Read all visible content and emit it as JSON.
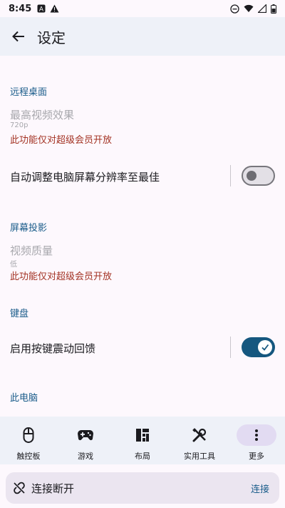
{
  "status_bar": {
    "time": "8:45"
  },
  "header": {
    "title": "设定"
  },
  "sections": {
    "remote_desktop": {
      "header": "远程桌面",
      "video_quality": {
        "title": "最高视频效果",
        "value": "720p",
        "notice": "此功能仅对超级会员开放"
      },
      "auto_resize": {
        "label": "自动调整电脑屏幕分辨率至最佳",
        "enabled": false
      }
    },
    "screen_cast": {
      "header": "屏幕投影",
      "video_quality": {
        "title": "视频质量",
        "value": "低",
        "notice": "此功能仅对超级会员开放"
      }
    },
    "keyboard": {
      "header": "键盘",
      "haptic": {
        "label": "启用按键震动回馈",
        "enabled": true
      }
    },
    "this_pc": {
      "header": "此电脑"
    }
  },
  "bottom_nav": {
    "items": [
      {
        "label": "触控板",
        "icon": "mouse-icon"
      },
      {
        "label": "游戏",
        "icon": "gamepad-icon"
      },
      {
        "label": "布局",
        "icon": "layout-icon"
      },
      {
        "label": "实用工具",
        "icon": "tools-icon"
      },
      {
        "label": "更多",
        "icon": "more-vert-icon",
        "active": true
      }
    ]
  },
  "connection": {
    "status": "连接断开",
    "action": "连接"
  },
  "colors": {
    "accent": "#15577f",
    "warning": "#a33223",
    "section": "#1a5c8a"
  }
}
